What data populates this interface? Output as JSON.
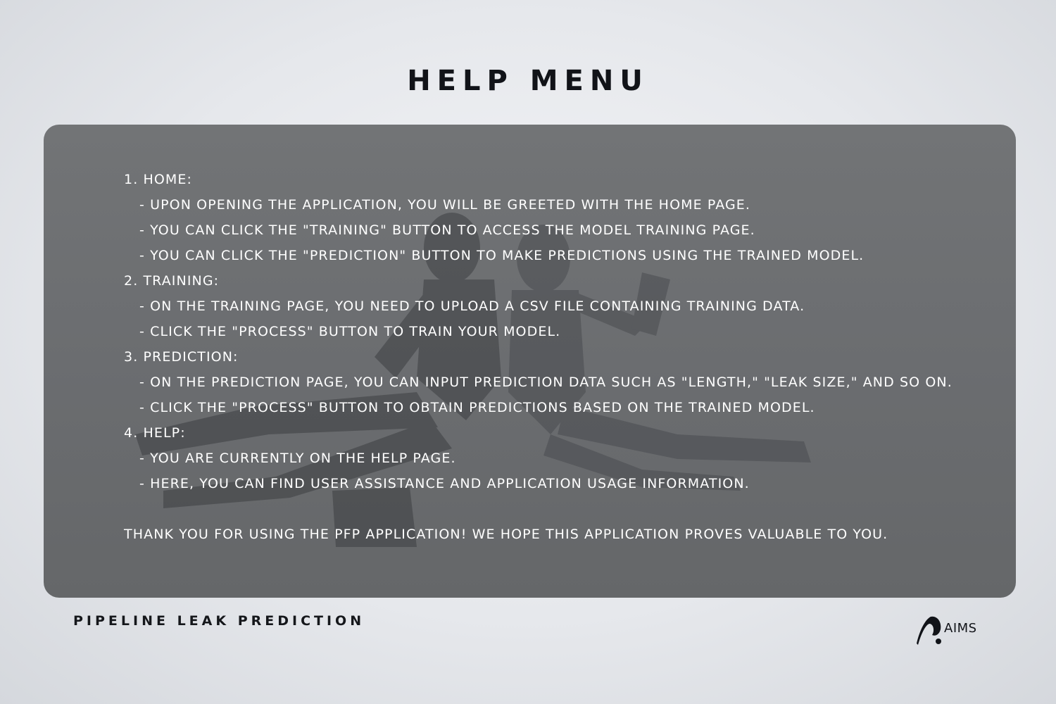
{
  "header": {
    "title": "Help Menu"
  },
  "help": {
    "sections": [
      {
        "heading": "1. Home:",
        "items": [
          "- Upon opening the application, you will be greeted with the home page.",
          "- You can click the \"Training\" button to access the model training page.",
          "- You can click the \"Prediction\" button to make predictions using the trained model."
        ]
      },
      {
        "heading": "2. Training:",
        "items": [
          "- On the training page, you need to upload a CSV file containing training data.",
          "- Click the \"Process\" button to train your model."
        ]
      },
      {
        "heading": "3. Prediction:",
        "items": [
          "- On the prediction page, you can input prediction data such as \"Length,\" \"Leak Size,\" and so on.",
          "- Click the \"Process\" button to obtain predictions based on the trained model."
        ]
      },
      {
        "heading": "4. Help:",
        "items": [
          "- You are currently on the help page.",
          "- Here, you can find user assistance and application usage information."
        ]
      }
    ],
    "closing": "Thank you for using the PFP application! We hope this application proves valuable to you."
  },
  "footer": {
    "app_name": "Pipeline Leak Prediction",
    "logo_text": "AIMS"
  },
  "colors": {
    "panel": "#6b6d70",
    "title": "#111318",
    "text": "#ffffff"
  }
}
